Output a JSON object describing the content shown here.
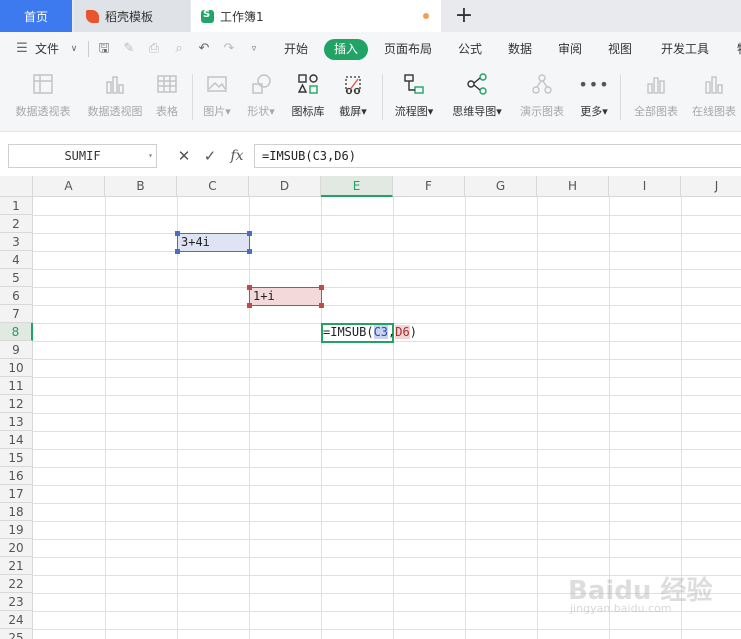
{
  "tabs": {
    "home": "首页",
    "template": "稻壳模板",
    "workbook": "工作簿1",
    "add": "+"
  },
  "menu": {
    "file": "文件",
    "items": [
      "开始",
      "插入",
      "页面布局",
      "公式",
      "数据",
      "审阅",
      "视图",
      "开发工具"
    ],
    "active": "插入",
    "overflow": "特"
  },
  "ribbon": {
    "pivot_table": "数据透视表",
    "pivot_chart": "数据透视图",
    "table": "表格",
    "picture": "图片",
    "shape": "形状",
    "icon_library": "图标库",
    "screenshot": "截屏",
    "flowchart": "流程图",
    "mindmap": "思维导图",
    "demo_chart": "演示图表",
    "more": "更多",
    "all_charts": "全部图表",
    "online_chart": "在线图表"
  },
  "formula_bar": {
    "name_box": "SUMIF",
    "fx": "fx",
    "formula": "=IMSUB(C3,D6)"
  },
  "grid": {
    "columns": [
      "A",
      "B",
      "C",
      "D",
      "E",
      "F",
      "G",
      "H",
      "I",
      "J"
    ],
    "active_column": "E",
    "rows": [
      "1",
      "2",
      "3",
      "4",
      "5",
      "6",
      "7",
      "8",
      "9",
      "10",
      "11",
      "12",
      "13",
      "14",
      "15",
      "16",
      "17",
      "18",
      "19",
      "20",
      "21",
      "22",
      "23",
      "24",
      "25"
    ],
    "active_row": "8",
    "cells": {
      "C3": "3+4i",
      "D6": "1+i"
    },
    "editing": {
      "cell": "E8",
      "prefix": "=IMSUB(",
      "ref1": "C3",
      "sep": ",",
      "ref2": "D6",
      "suffix": ")"
    }
  },
  "watermark": {
    "text": "Baidu 经验",
    "sub": "jingyan.baidu.com"
  },
  "colors": {
    "accent_green": "#21a366",
    "tab_blue": "#3d7af0",
    "ref_blue": "#4a6ec8",
    "ref_red": "#c04a4a"
  }
}
